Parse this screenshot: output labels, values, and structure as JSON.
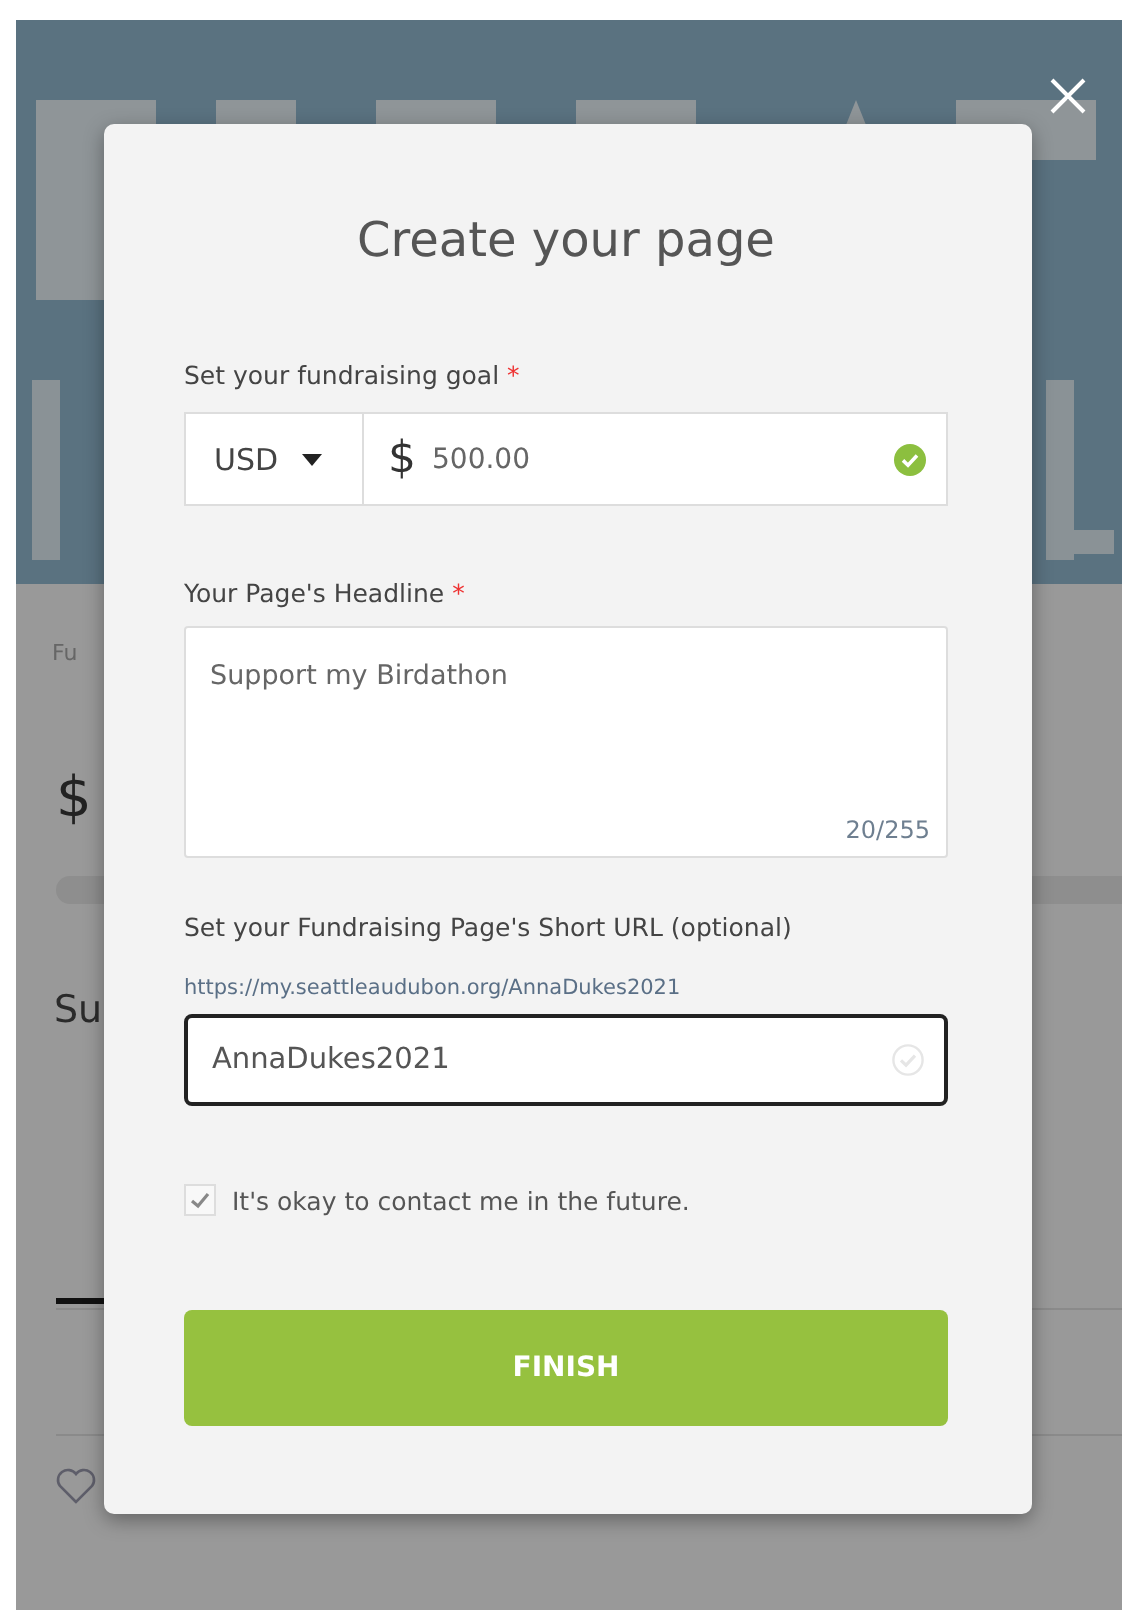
{
  "page": {
    "breadcrumb": "Fu",
    "amount": "$",
    "heading": "Su"
  },
  "modal": {
    "title": "Create your page",
    "goal": {
      "label": "Set your fundraising goal",
      "required_mark": "*",
      "currency": "USD",
      "symbol": "$",
      "value": "500.00",
      "valid": true
    },
    "headline": {
      "label": "Your Page's Headline",
      "required_mark": "*",
      "value": "Support my Birdathon",
      "counter": "20/255"
    },
    "short_url": {
      "label": "Set your Fundraising Page's Short URL (optional)",
      "preview": "https://my.seattleaudubon.org/AnnaDukes2021",
      "value": "AnnaDukes2021",
      "valid": false,
      "focused": true
    },
    "contact": {
      "label": "It's okay to contact me in the future.",
      "checked": true
    },
    "finish_button": "FINISH"
  }
}
